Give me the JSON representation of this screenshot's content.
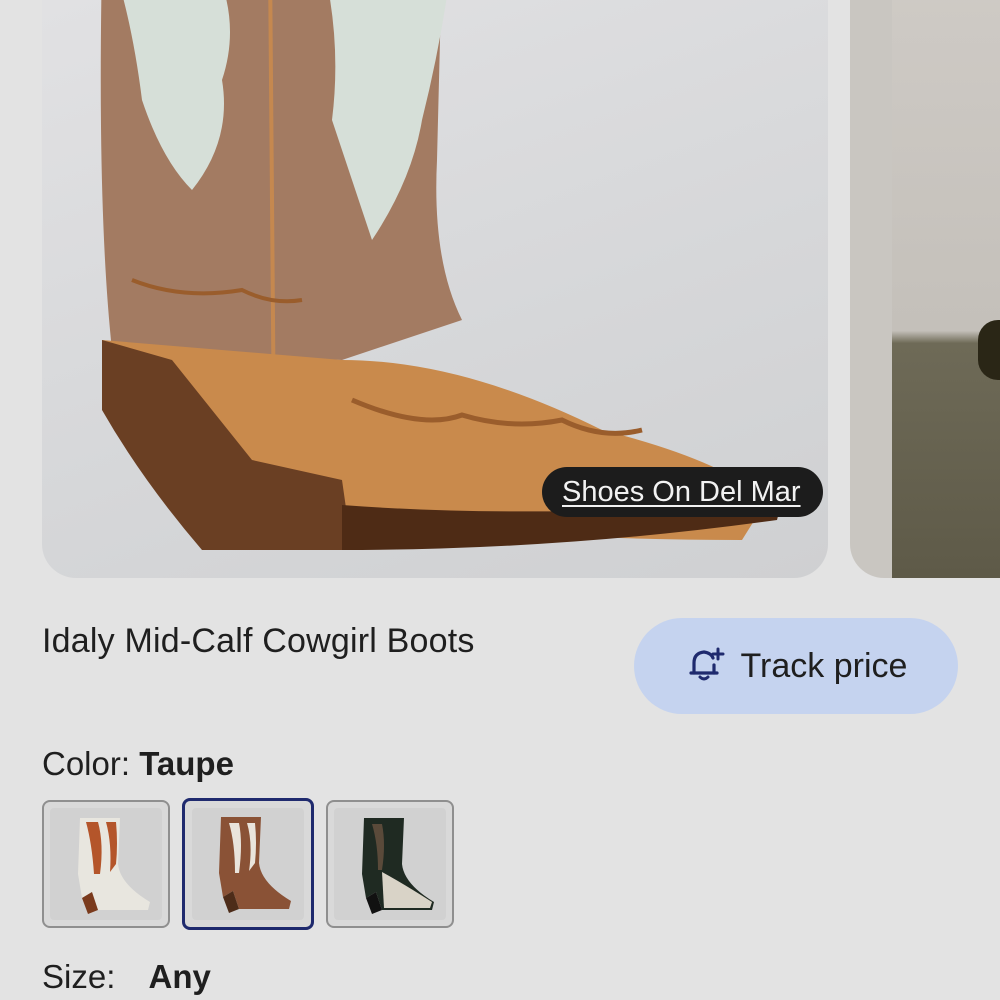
{
  "hero": {
    "source_label": "Shoes On Del Mar",
    "image_name": "taupe-cowgirl-boot"
  },
  "product": {
    "title": "Idaly Mid-Calf Cowgirl Boots"
  },
  "track_price": {
    "label": "Track price",
    "icon": "bell-plus-icon",
    "color": "#c5d3ef"
  },
  "color": {
    "label": "Color:",
    "selected": "Taupe",
    "options": [
      {
        "name": "white-rust",
        "upper": "#e8e6df",
        "accent": "#b4552a"
      },
      {
        "name": "taupe",
        "upper": "#8a5236",
        "accent": "#e9e4dc"
      },
      {
        "name": "black-white",
        "upper": "#1f2a22",
        "accent": "#d9d3c7"
      }
    ],
    "selected_index": 1
  },
  "size": {
    "label": "Size:",
    "value": "Any"
  },
  "colors": {
    "background": "#e3e3e3",
    "selected_border": "#1f2a6e"
  }
}
